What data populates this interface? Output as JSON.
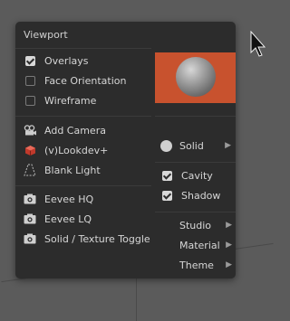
{
  "menu": {
    "title": "Viewport",
    "toggles": [
      {
        "label": "Overlays",
        "checked": true
      },
      {
        "label": "Face Orientation",
        "checked": false
      },
      {
        "label": "Wireframe",
        "checked": false
      }
    ],
    "actions": [
      {
        "label": "Add Camera",
        "icon": "camera-icon"
      },
      {
        "label": "(v)Lookdev+",
        "icon": "cube-icon"
      },
      {
        "label": "Blank Light",
        "icon": "spotlight-icon"
      }
    ],
    "renders": [
      {
        "label": "Eevee HQ",
        "icon": "screenshot-icon"
      },
      {
        "label": "Eevee LQ",
        "icon": "screenshot-icon"
      },
      {
        "label": "Solid / Texture Toggle",
        "icon": "screenshot-icon"
      }
    ],
    "shading_label": "Solid",
    "right_toggles": [
      {
        "label": "Cavity",
        "checked": true
      },
      {
        "label": "Shadow",
        "checked": true
      }
    ],
    "submenus": [
      "Studio",
      "Material",
      "Theme"
    ],
    "preview_color": "#c8522e"
  }
}
